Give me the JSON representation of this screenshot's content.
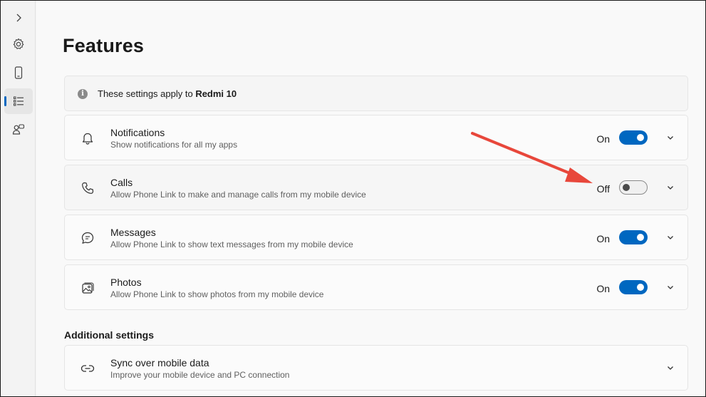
{
  "rail": {
    "items": [
      {
        "icon": "chevron-right-icon"
      },
      {
        "icon": "gear-icon"
      },
      {
        "icon": "phone-icon"
      },
      {
        "icon": "features-list-icon",
        "active": true
      },
      {
        "icon": "people-icon"
      }
    ]
  },
  "page": {
    "title": "Features"
  },
  "info": {
    "prefix": "These settings apply to ",
    "device": "Redmi 10"
  },
  "features": [
    {
      "title": "Notifications",
      "subtitle": "Show notifications for all my apps",
      "state": "On",
      "on": true,
      "icon": "bell-icon"
    },
    {
      "title": "Calls",
      "subtitle": "Allow Phone Link to make and manage calls from my mobile device",
      "state": "Off",
      "on": false,
      "icon": "phone-call-icon"
    },
    {
      "title": "Messages",
      "subtitle": "Allow Phone Link to show text messages from my mobile device",
      "state": "On",
      "on": true,
      "icon": "chat-bubble-icon"
    },
    {
      "title": "Photos",
      "subtitle": "Allow Phone Link to show photos from my mobile device",
      "state": "On",
      "on": true,
      "icon": "photos-icon"
    }
  ],
  "additional": {
    "heading": "Additional settings",
    "items": [
      {
        "title": "Sync over mobile data",
        "subtitle": "Improve your mobile device and PC connection",
        "icon": "link-icon"
      }
    ]
  },
  "colors": {
    "accent": "#0067c0",
    "annotation_arrow": "#e8473b"
  }
}
